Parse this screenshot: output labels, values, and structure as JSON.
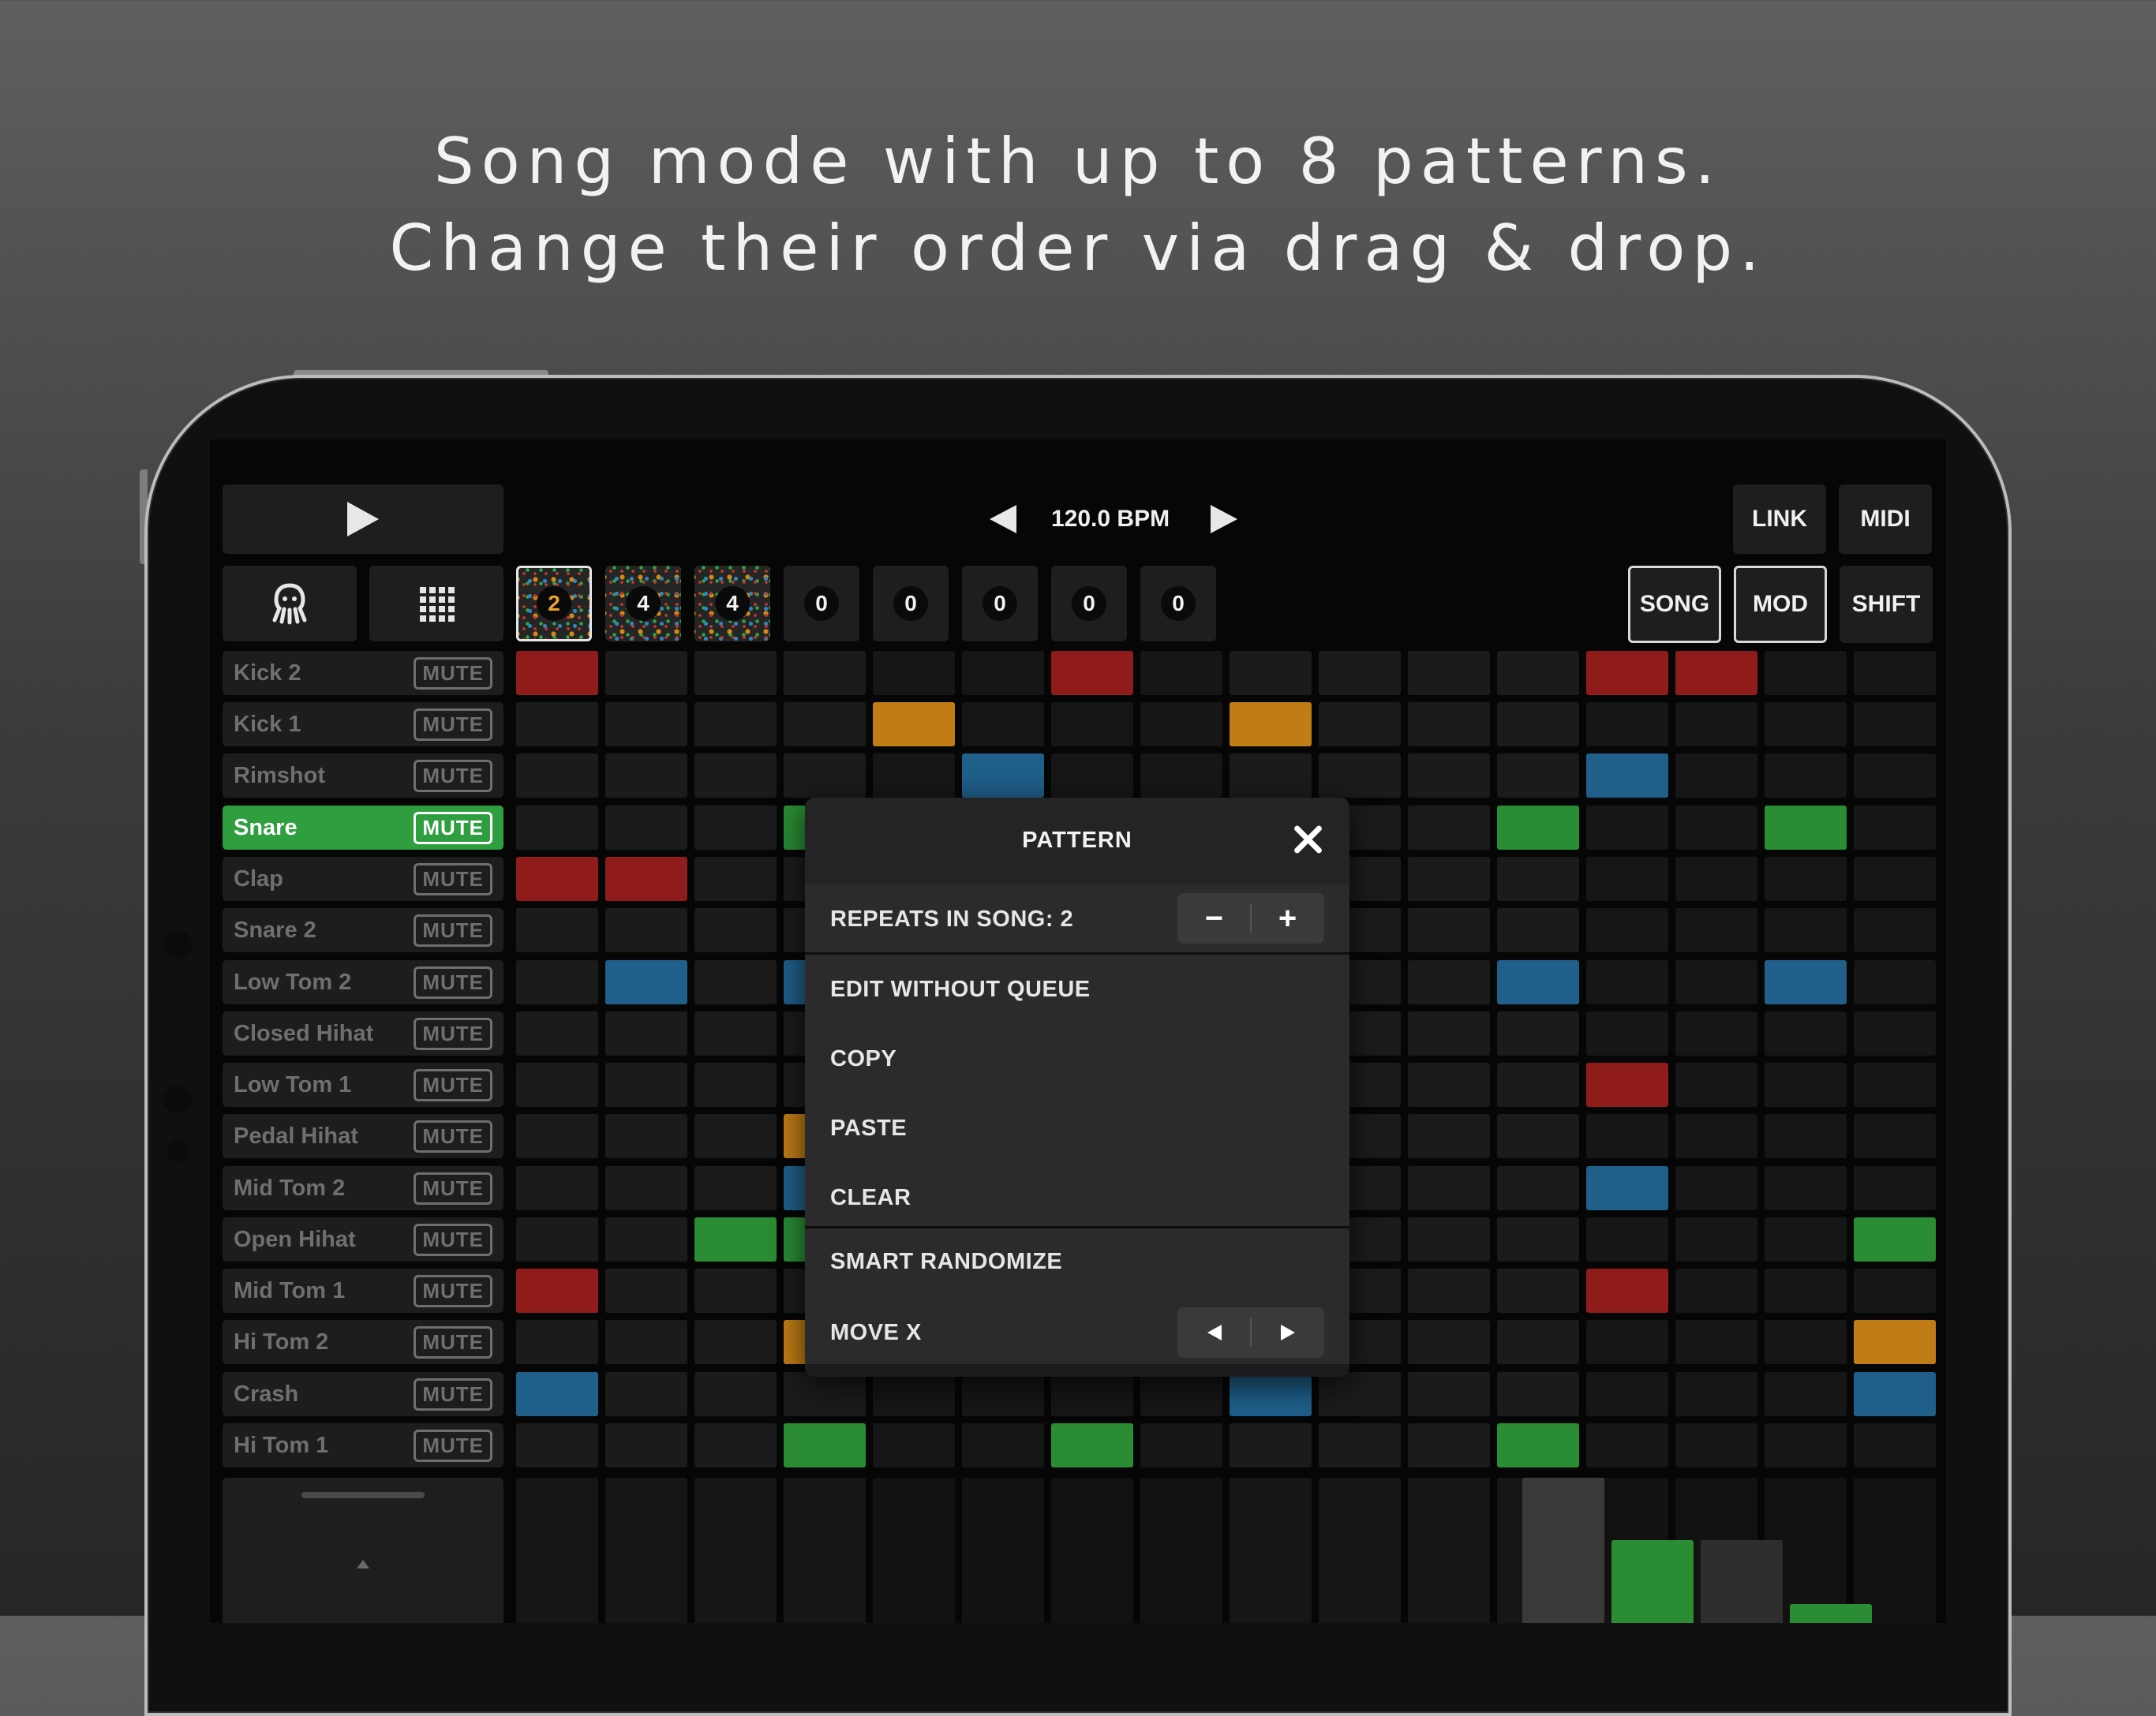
{
  "headline": {
    "line1": "Song mode with up to 8 patterns.",
    "line2": "Change their order via drag & drop."
  },
  "transport": {
    "bpm_label": "120.0 BPM"
  },
  "top_buttons": {
    "link": "LINK",
    "midi": "MIDI",
    "song": "SONG",
    "mod": "MOD",
    "shift": "SHIFT"
  },
  "patterns": [
    "2",
    "4",
    "4",
    "0",
    "0",
    "0",
    "0",
    "0"
  ],
  "tracks": [
    {
      "name": "Kick 2",
      "mute": "MUTE"
    },
    {
      "name": "Kick 1",
      "mute": "MUTE"
    },
    {
      "name": "Rimshot",
      "mute": "MUTE"
    },
    {
      "name": "Snare",
      "mute": "MUTE"
    },
    {
      "name": "Clap",
      "mute": "MUTE"
    },
    {
      "name": "Snare 2",
      "mute": "MUTE"
    },
    {
      "name": "Low Tom 2",
      "mute": "MUTE"
    },
    {
      "name": "Closed Hihat",
      "mute": "MUTE"
    },
    {
      "name": "Low Tom 1",
      "mute": "MUTE"
    },
    {
      "name": "Pedal Hihat",
      "mute": "MUTE"
    },
    {
      "name": "Mid Tom 2",
      "mute": "MUTE"
    },
    {
      "name": "Open Hihat",
      "mute": "MUTE"
    },
    {
      "name": "Mid Tom 1",
      "mute": "MUTE"
    },
    {
      "name": "Hi Tom 2",
      "mute": "MUTE"
    },
    {
      "name": "Crash",
      "mute": "MUTE"
    },
    {
      "name": "Hi Tom 1",
      "mute": "MUTE"
    }
  ],
  "popup": {
    "title": "PATTERN",
    "repeats_label": "REPEATS IN SONG: 2",
    "minus": "−",
    "plus": "+",
    "edit_without_queue": "EDIT WITHOUT QUEUE",
    "copy": "COPY",
    "paste": "PASTE",
    "clear": "CLEAR",
    "smart_randomize": "SMART RANDOMIZE",
    "move_x": "MOVE X"
  },
  "colors": {
    "red": "#8f1b1b",
    "orange": "#c07d16",
    "blue": "#1f5f8a",
    "green": "#2a8c33",
    "active_track": "#2f9e3f"
  },
  "icons": {
    "play": "play-icon",
    "bpm_down": "left-arrow-icon",
    "bpm_up": "right-arrow-icon",
    "kit": "octopus-icon",
    "grid": "grid-icon",
    "close": "close-icon"
  }
}
